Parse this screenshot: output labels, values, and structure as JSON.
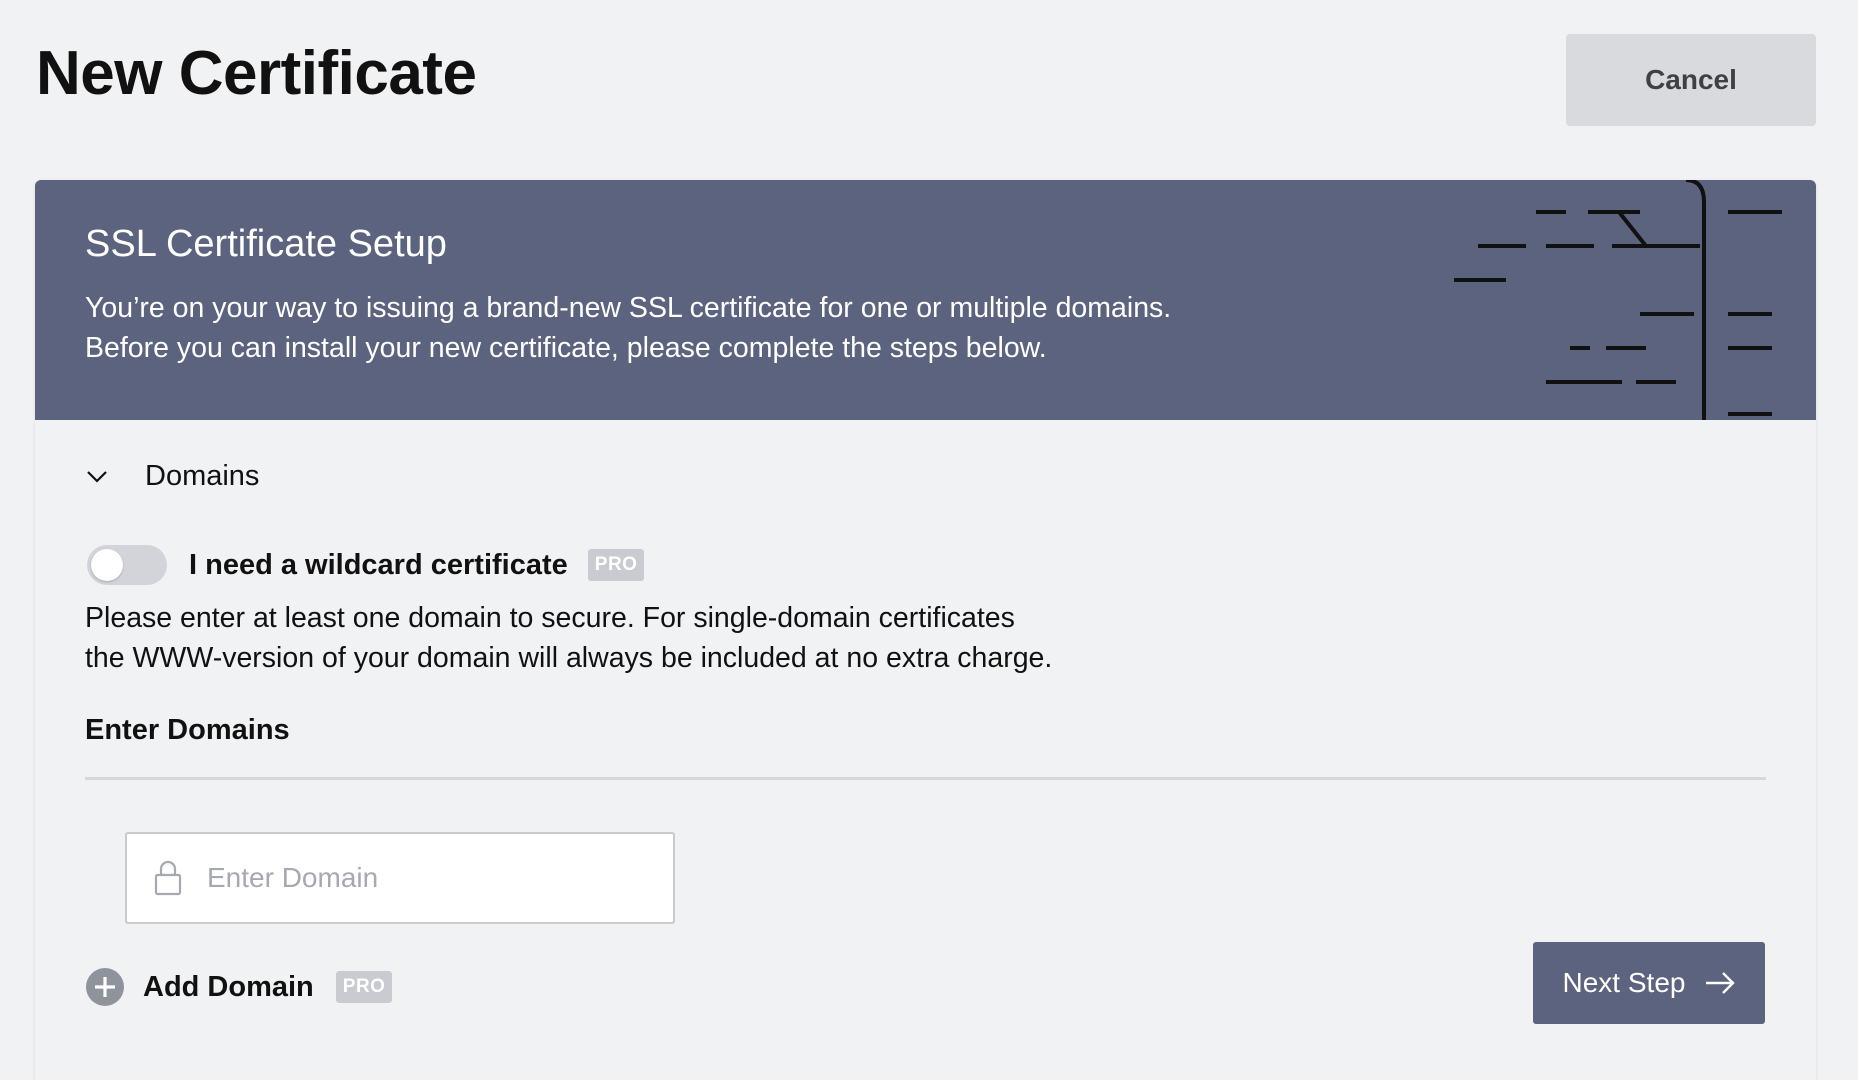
{
  "page": {
    "title": "New Certificate",
    "cancel_label": "Cancel"
  },
  "banner": {
    "title": "SSL Certificate Setup",
    "text_line1": "You’re on your way to issuing a brand-new SSL certificate for one or multiple domains.",
    "text_line2": "Before you can install your new certificate, please complete the steps below.",
    "background_color": "#5b637e"
  },
  "domains_section": {
    "title": "Domains",
    "expanded": true,
    "wildcard_toggle": {
      "label": "I need a wildcard certificate",
      "checked": false,
      "badge": "PRO"
    },
    "help_line1": "Please enter at least one domain to secure. For single-domain certificates",
    "help_line2": "the WWW-version of your domain will always be included at no extra charge.",
    "enter_domains_label": "Enter Domains",
    "domain_input": {
      "value": "",
      "placeholder": "Enter Domain"
    },
    "add_domain": {
      "label": "Add Domain",
      "badge": "PRO"
    },
    "next_step_label": "Next Step"
  },
  "icons": {
    "chevron": "chevron-down-icon",
    "lock": "lock-icon",
    "plus": "plus-circle-icon",
    "arrow": "arrow-right-icon"
  }
}
